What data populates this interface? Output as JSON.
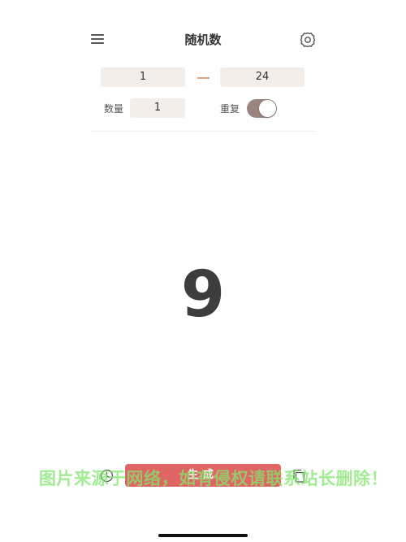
{
  "header": {
    "title": "随机数",
    "menu_icon": "hamburger-menu-icon",
    "settings_icon": "gear-icon"
  },
  "range": {
    "min_value": "1",
    "max_value": "24",
    "dash_color": "#e0a27f"
  },
  "options": {
    "quantity_label": "数量",
    "quantity_value": "1",
    "repeat_label": "重复",
    "repeat_enabled": true
  },
  "result": {
    "value": "9"
  },
  "bottom_bar": {
    "history_icon": "clock-icon",
    "generate_label": "生成",
    "copy_icon": "copy-icon",
    "accent_color": "#e06665"
  },
  "watermark": {
    "text": "图片来源于网络，如有侵权请联系站长删除！"
  }
}
